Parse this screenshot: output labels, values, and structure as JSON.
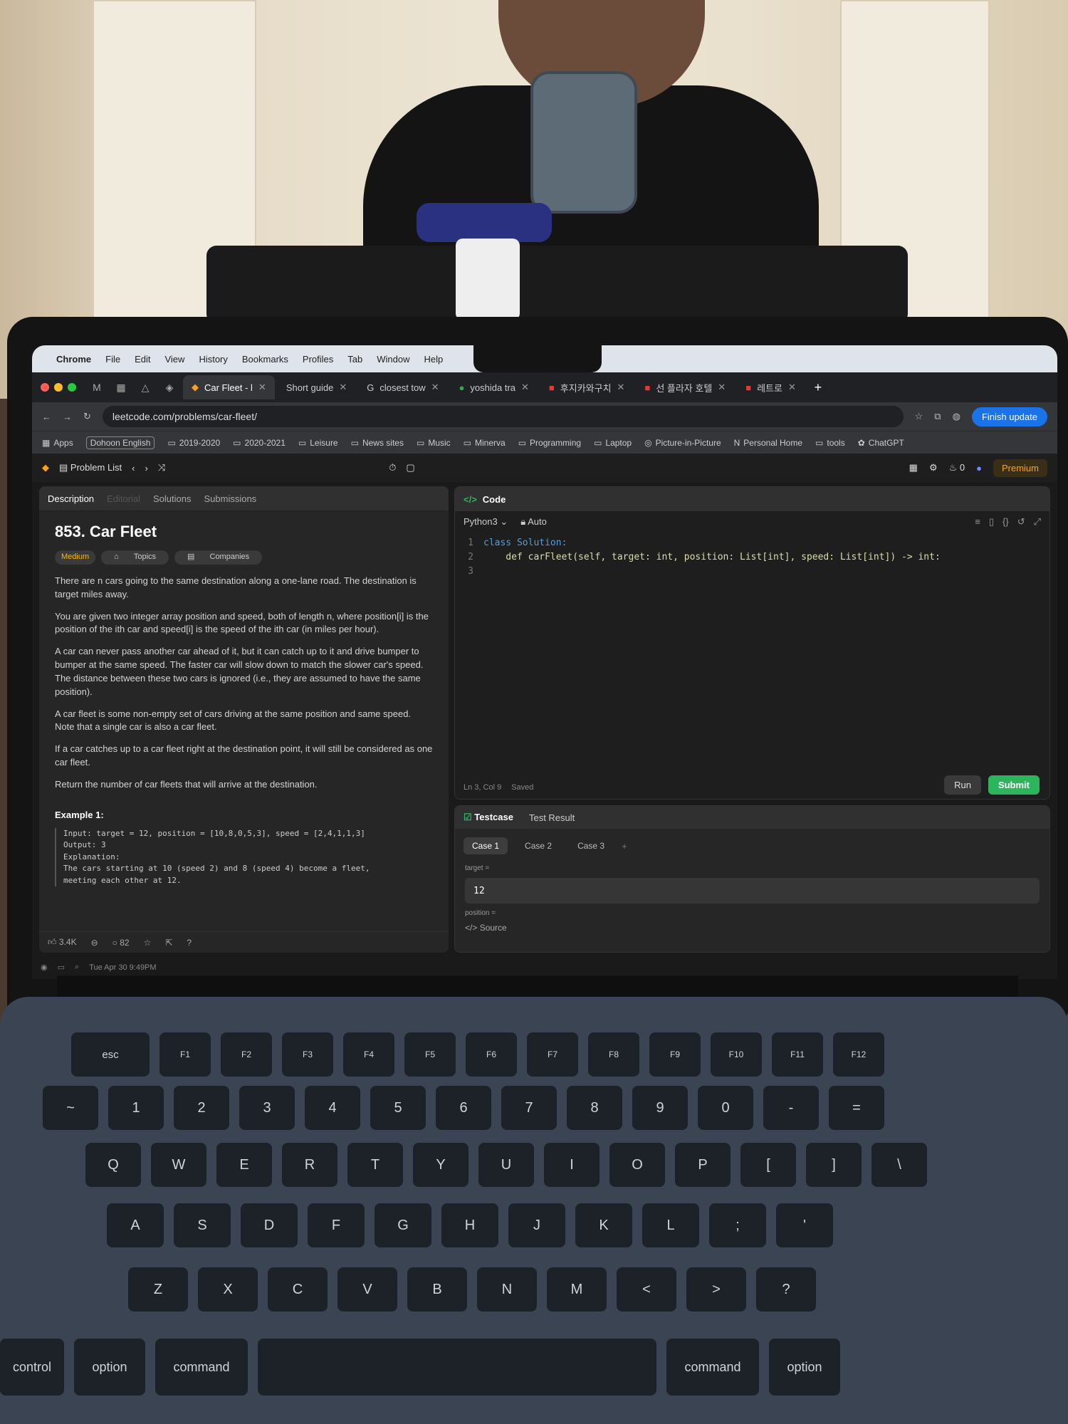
{
  "menubar": {
    "items": [
      "Chrome",
      "File",
      "Edit",
      "View",
      "History",
      "Bookmarks",
      "Profiles",
      "Tab",
      "Window",
      "Help"
    ],
    "datetime": "Tue Apr 30  9:49PM"
  },
  "tabs": [
    {
      "title": "Car Fleet - l",
      "active": true
    },
    {
      "title": "Short guide",
      "active": false
    },
    {
      "title": "closest tow",
      "active": false
    },
    {
      "title": "yoshida tra",
      "active": false
    },
    {
      "title": "후지카와구치",
      "active": false
    },
    {
      "title": "선 플라자 호텔",
      "active": false
    },
    {
      "title": "레트로",
      "active": false
    }
  ],
  "address": {
    "url": "leetcode.com/problems/car-fleet/",
    "finish_update": "Finish update"
  },
  "bookmarks": [
    "Apps",
    "Dohoon English",
    "2019-2020",
    "2020-2021",
    "Leisure",
    "News sites",
    "Music",
    "Minerva",
    "Programming",
    "Laptop",
    "Picture-in-Picture",
    "Personal Home",
    "tools",
    "ChatGPT"
  ],
  "lcnav": {
    "problem_list": "Problem List",
    "streak": "0",
    "premium": "Premium"
  },
  "left_tabs": [
    "Description",
    "Editorial",
    "Solutions",
    "Submissions"
  ],
  "problem": {
    "title": "853. Car Fleet",
    "difficulty": "Medium",
    "topics": "Topics",
    "companies": "Companies",
    "paragraphs": [
      "There are n cars going to the same destination along a one-lane road. The destination is target miles away.",
      "You are given two integer array position and speed, both of length n, where position[i] is the position of the ith car and speed[i] is the speed of the ith car (in miles per hour).",
      "A car can never pass another car ahead of it, but it can catch up to it and drive bumper to bumper at the same speed. The faster car will slow down to match the slower car's speed. The distance between these two cars is ignored (i.e., they are assumed to have the same position).",
      "A car fleet is some non-empty set of cars driving at the same position and same speed. Note that a single car is also a car fleet.",
      "If a car catches up to a car fleet right at the destination point, it will still be considered as one car fleet.",
      "Return the number of car fleets that will arrive at the destination."
    ],
    "example_title": "Example 1:",
    "example_code": "Input: target = 12, position = [10,8,0,5,3], speed = [2,4,1,1,3]\nOutput: 3\nExplanation:\nThe cars starting at 10 (speed 2) and 8 (speed 4) become a fleet,\nmeeting each other at 12.",
    "likes": "3.4K",
    "comments": "82"
  },
  "code": {
    "header": "Code",
    "language": "Python3",
    "mode": "Auto",
    "lines": [
      {
        "n": "1",
        "text": "class Solution:"
      },
      {
        "n": "2",
        "text": "    def carFleet(self, target: int, position: List[int], speed: List[int]) -> int:"
      },
      {
        "n": "3",
        "text": ""
      }
    ],
    "cursor": "Ln 3, Col 9",
    "saved": "Saved",
    "run": "Run",
    "submit": "Submit"
  },
  "testcase": {
    "tab": "Testcase",
    "result_tab": "Test Result",
    "cases": [
      "Case 1",
      "Case 2",
      "Case 3"
    ],
    "target_label": "target =",
    "target_value": "12",
    "position_label": "position =",
    "source": "Source"
  },
  "keyboard": {
    "row_fn": [
      "esc",
      "F1",
      "F2",
      "F3",
      "F4",
      "F5",
      "F6",
      "F7",
      "F8",
      "F9",
      "F10",
      "F11",
      "F12"
    ],
    "row_num": [
      "~",
      "1",
      "2",
      "3",
      "4",
      "5",
      "6",
      "7",
      "8",
      "9",
      "0",
      "-",
      "="
    ],
    "row_q": [
      "Q",
      "W",
      "E",
      "R",
      "T",
      "Y",
      "U",
      "I",
      "O",
      "P",
      "[",
      "]",
      "\\"
    ],
    "row_a": [
      "A",
      "S",
      "D",
      "F",
      "G",
      "H",
      "J",
      "K",
      "L",
      ";",
      "'"
    ],
    "row_z": [
      "Z",
      "X",
      "C",
      "V",
      "B",
      "N",
      "M",
      "<",
      ">",
      "?"
    ],
    "row_mod": [
      "control",
      "option",
      "command",
      "command",
      "option"
    ]
  },
  "colors": {
    "accent_green": "#2db55d",
    "premium": "#ffa116",
    "medium": "#ffb800",
    "chrome_blue": "#1a73e8"
  }
}
